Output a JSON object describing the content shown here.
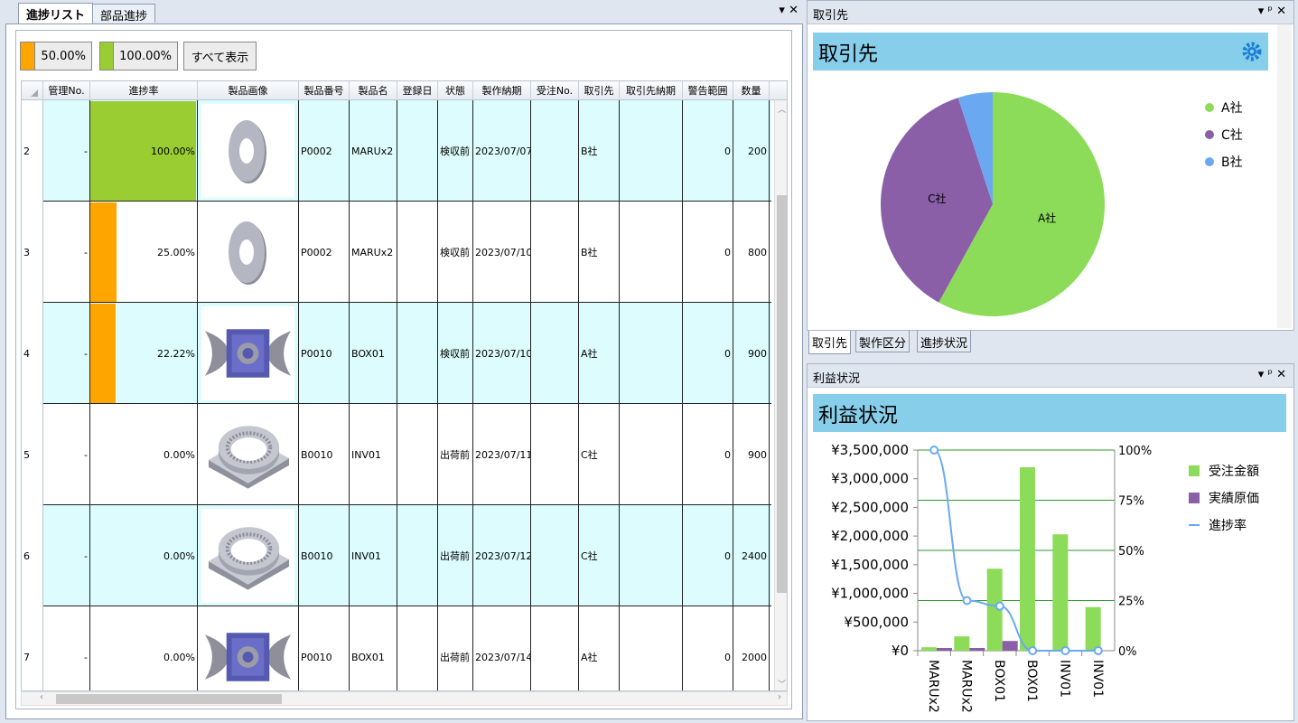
{
  "left": {
    "tabs": [
      {
        "label": "進捗リスト"
      },
      {
        "label": "部品進捗"
      }
    ],
    "filters": [
      {
        "label": "50.00%",
        "color": "#ffa500"
      },
      {
        "label": "100.00%",
        "color": "#9acd32"
      },
      {
        "label": "すべて表示"
      }
    ],
    "columns": [
      "管理No.",
      "進捗率",
      "製品画像",
      "製品番号",
      "製品名",
      "登録日",
      "状態",
      "製作納期",
      "受注No.",
      "取引先",
      "取引先納期",
      "警告範囲",
      "数量"
    ],
    "rows": [
      {
        "row": "2",
        "kanri": "-",
        "progress": 100,
        "progress_label": "100.00%",
        "image": "washer",
        "code": "P0002",
        "name": "MARUx2",
        "reg": "",
        "status": "検収前",
        "due": "2023/07/07",
        "order": "",
        "client": "B社",
        "client_due": "",
        "warn": "0",
        "qty": "200"
      },
      {
        "row": "3",
        "kanri": "-",
        "progress": 25,
        "progress_label": "25.00%",
        "image": "washer",
        "code": "P0002",
        "name": "MARUx2",
        "reg": "",
        "status": "検収前",
        "due": "2023/07/10",
        "order": "",
        "client": "B社",
        "client_due": "",
        "warn": "0",
        "qty": "800"
      },
      {
        "row": "4",
        "kanri": "-",
        "progress": 22.22,
        "progress_label": "22.22%",
        "image": "box",
        "code": "P0010",
        "name": "BOX01",
        "reg": "",
        "status": "検収前",
        "due": "2023/07/10",
        "order": "",
        "client": "A社",
        "client_due": "",
        "warn": "0",
        "qty": "900"
      },
      {
        "row": "5",
        "kanri": "-",
        "progress": 0,
        "progress_label": "0.00%",
        "image": "gear",
        "code": "B0010",
        "name": "INV01",
        "reg": "",
        "status": "出荷前",
        "due": "2023/07/11",
        "order": "",
        "client": "C社",
        "client_due": "",
        "warn": "0",
        "qty": "900"
      },
      {
        "row": "6",
        "kanri": "-",
        "progress": 0,
        "progress_label": "0.00%",
        "image": "gear",
        "code": "B0010",
        "name": "INV01",
        "reg": "",
        "status": "出荷前",
        "due": "2023/07/12",
        "order": "",
        "client": "C社",
        "client_due": "",
        "warn": "0",
        "qty": "2400"
      },
      {
        "row": "7",
        "kanri": "-",
        "progress": 0,
        "progress_label": "0.00%",
        "image": "box",
        "code": "P0010",
        "name": "BOX01",
        "reg": "",
        "status": "出荷前",
        "due": "2023/07/14",
        "order": "",
        "client": "A社",
        "client_due": "",
        "warn": "0",
        "qty": "2000"
      }
    ],
    "progress_colors": {
      "full": "#9acd32",
      "partial": "#ffa500"
    }
  },
  "client_panel": {
    "title_bar": "取引先",
    "heading": "取引先",
    "tabs": [
      "取引先",
      "製作区分",
      "進捗状況"
    ],
    "chart": {
      "type": "pie",
      "slices": [
        {
          "label": "A社",
          "value": 58,
          "color": "#8cdc5a"
        },
        {
          "label": "C社",
          "value": 37,
          "color": "#8b5ea8"
        },
        {
          "label": "B社",
          "value": 5,
          "color": "#6aa9f2"
        }
      ]
    }
  },
  "profit_panel": {
    "title_bar": "利益状況",
    "heading": "利益状況",
    "chart": {
      "type": "bar",
      "categories": [
        "MARUx2",
        "MARUx2",
        "BOX01",
        "BOX01",
        "INV01",
        "INV01"
      ],
      "series": [
        {
          "name": "受注金額",
          "color": "#8cdc5a",
          "values": [
            60000,
            250000,
            1430000,
            3200000,
            2030000,
            760000
          ]
        },
        {
          "name": "実績原価",
          "color": "#8b5ea8",
          "values": [
            30000,
            30000,
            170000,
            0,
            0,
            0
          ]
        },
        {
          "name": "進捗率",
          "color": "#6aa9f2",
          "type": "line",
          "values": [
            100,
            25,
            22.22,
            0,
            0,
            0
          ]
        }
      ],
      "y_ticks": [
        "¥0",
        "¥500,000",
        "¥1,000,000",
        "¥1,500,000",
        "¥2,000,000",
        "¥2,500,000",
        "¥3,000,000",
        "¥3,500,000"
      ],
      "ylim": [
        0,
        3500000
      ],
      "y2_ticks": [
        "0%",
        "25%",
        "50%",
        "75%",
        "100%"
      ],
      "y2lim": [
        0,
        100
      ]
    }
  }
}
